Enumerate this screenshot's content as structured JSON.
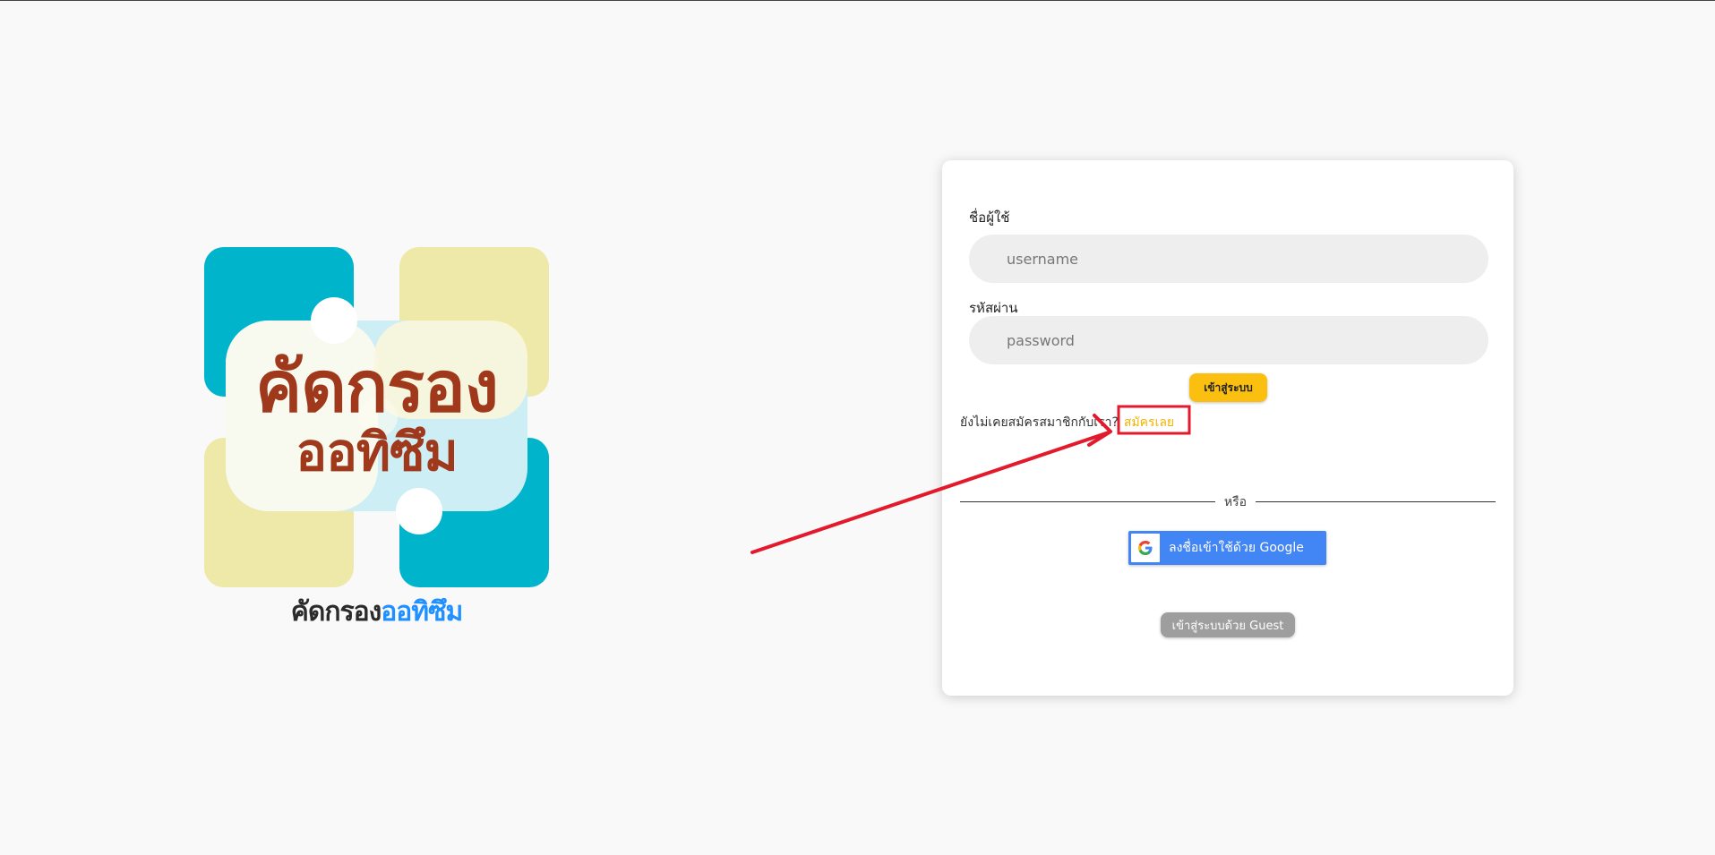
{
  "logo": {
    "title_line1": "คัดกรอง",
    "title_line2": "ออทิซึม",
    "caption_part1": "คัดกรอง",
    "caption_part2": "ออทิซึม",
    "colors": {
      "teal": "#00b4cc",
      "yellow": "#eee8a9",
      "light_blue": "#cdeef5",
      "title_red": "#a0391c",
      "caption_blue": "#1e90ff"
    }
  },
  "login_form": {
    "username_label": "ชื่อผู้ใช้",
    "username_placeholder": "username",
    "username_value": "",
    "password_label": "รหัสผ่าน",
    "password_placeholder": "password",
    "password_value": "",
    "login_button": "เข้าสู่ระบบ",
    "signup_prompt": "ยังไม่เคยสมัครสมาชิกกับเรา?",
    "signup_link": "สมัครเลย",
    "divider_text": "หรือ",
    "google_button": "ลงชื่อเข้าใช้ด้วย Google",
    "guest_button": "เข้าสู่ระบบด้วย Guest",
    "icons": {
      "google": "google-g-icon"
    },
    "colors": {
      "login_button": "#fbbf10",
      "signup_link": "#f0b400",
      "google_button": "#4285f4",
      "guest_button": "#9e9e9e"
    }
  },
  "annotation": {
    "color": "#e3192c",
    "type": "arrow pointing to highlighted signup link"
  }
}
